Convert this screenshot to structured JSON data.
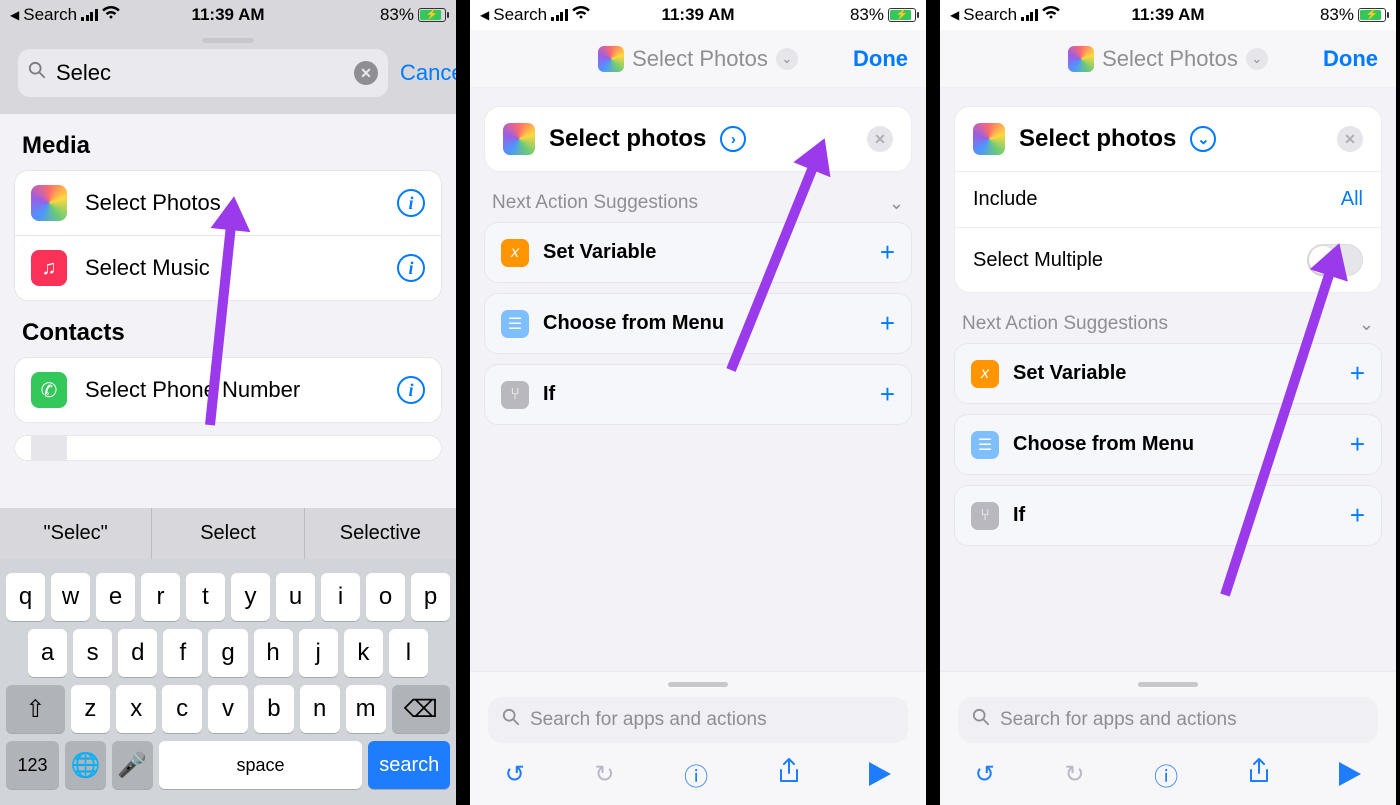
{
  "status": {
    "back_label": "Search",
    "time": "11:39 AM",
    "battery_pct": "83%"
  },
  "screen1": {
    "search_value": "Selec",
    "cancel": "Cancel",
    "sections": {
      "media_h": "Media",
      "contacts_h": "Contacts"
    },
    "rows": {
      "select_photos": "Select Photos",
      "select_music": "Select Music",
      "select_phone": "Select Phone Number"
    },
    "suggestions": [
      "\"Selec\"",
      "Select",
      "Selective"
    ],
    "keys_r1": [
      "q",
      "w",
      "e",
      "r",
      "t",
      "y",
      "u",
      "i",
      "o",
      "p"
    ],
    "keys_r2": [
      "a",
      "s",
      "d",
      "f",
      "g",
      "h",
      "j",
      "k",
      "l"
    ],
    "keys_r3": [
      "z",
      "x",
      "c",
      "v",
      "b",
      "n",
      "m"
    ],
    "space": "space",
    "search_key": "search",
    "numkey": "123"
  },
  "screen2": {
    "nav_title": "Select Photos",
    "done": "Done",
    "action_title": "Select photos",
    "suggestions_h": "Next Action Suggestions",
    "sug": {
      "set_var": "Set Variable",
      "choose_menu": "Choose from Menu",
      "if": "If"
    },
    "search_ph": "Search for apps and actions"
  },
  "screen3": {
    "nav_title": "Select Photos",
    "done": "Done",
    "action_title": "Select photos",
    "include_lbl": "Include",
    "include_val": "All",
    "multi_lbl": "Select Multiple",
    "suggestions_h": "Next Action Suggestions",
    "sug": {
      "set_var": "Set Variable",
      "choose_menu": "Choose from Menu",
      "if": "If"
    },
    "search_ph": "Search for apps and actions"
  }
}
